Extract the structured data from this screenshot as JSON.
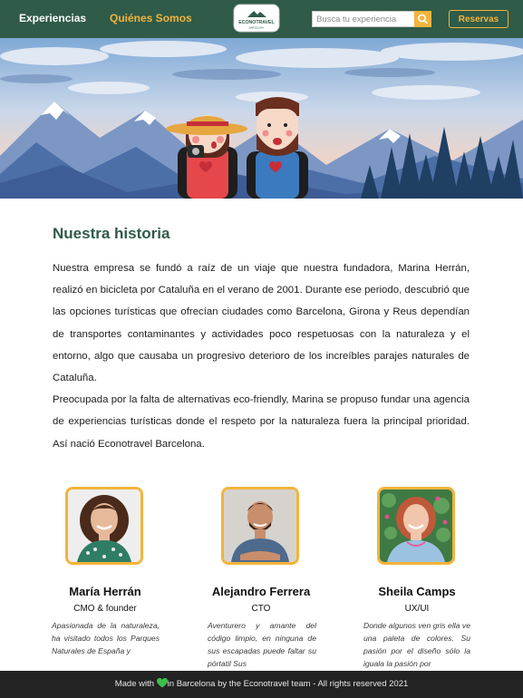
{
  "navbar": {
    "nav_experiencias": "Experiencias",
    "nav_quienes": "Quiénes Somos",
    "logo_text": "ECONOTRAVEL",
    "logo_subtext": "BARCELONA",
    "search_placeholder": "Busca tu experiencia",
    "search_icon": "search-icon",
    "reservas_label": "Reservas"
  },
  "hero": {
    "illustration": "two travelers in front of mountains and pine forest"
  },
  "story": {
    "title": "Nuestra historia",
    "paragraph_1": "Nuestra empresa se fundó a raíz de un viaje que nuestra fundadora, Marina Herrán, realizó en bicicleta por Cataluña en el verano de 2001. Durante ese periodo, descubrió que las opciones turísticas que ofrecían ciudades como Barcelona, Girona y Reus dependían de transportes contaminantes y actividades poco respetuosas con la naturaleza y el entorno, algo que causaba un progresivo deterioro de los increíbles parajes naturales de Cataluña.",
    "paragraph_2": "Preocupada por la falta de alternativas eco-friendly, Marina se propuso fundar una agencia de experiencias turísticas donde el respeto por la naturaleza fuera la principal prioridad. Así nació Econotravel Barcelona."
  },
  "team": [
    {
      "name": "María Herrán",
      "role": "CMO & founder",
      "bio": "Apasionada de la naturaleza, ha visitado todos los Parques Naturales de España y"
    },
    {
      "name": "Alejandro Ferrera",
      "role": "CTO",
      "bio": "Aventurero y amante del código limpio, en ninguna de sus escapadas puede faltar su pórtatil Sus"
    },
    {
      "name": "Sheila Camps",
      "role": "UX/UI",
      "bio": "Donde algunos ven gris ella ve una paleta de colores. Su pasión por el diseño sólo la iguala la pasión por"
    }
  ],
  "footer": {
    "text_before": "Made with ",
    "heart_icon": "green-heart-icon",
    "text_after": "in Barcelona by the Econotravel team - All rights reserved 2021"
  },
  "colors": {
    "brand_green": "#2f5b48",
    "accent_yellow": "#f2b43c",
    "footer_bg": "#232323"
  }
}
